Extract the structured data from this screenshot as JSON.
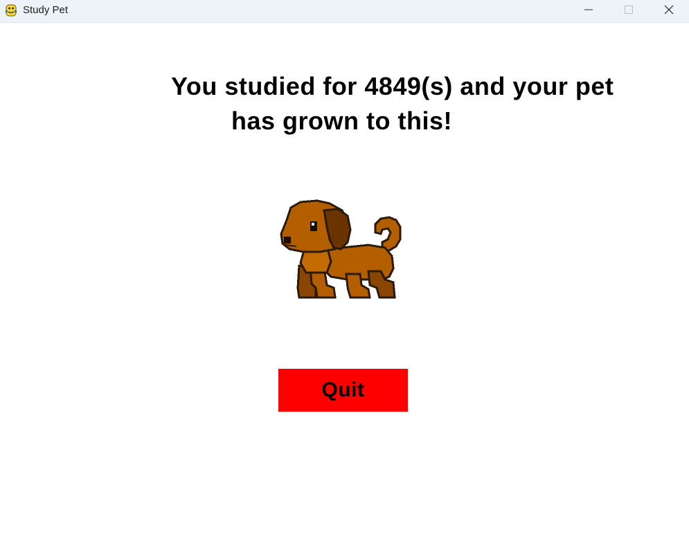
{
  "window": {
    "title": "Study Pet",
    "icon": "python-icon",
    "controls": {
      "minimize": "minimize-icon",
      "maximize": "maximize-icon",
      "close": "close-icon"
    }
  },
  "main": {
    "message_line_1": "You studied for 4849(s) and your pet",
    "message_line_2": "has grown to this!",
    "pet_image": "dog-sprite",
    "quit_label": "Quit"
  },
  "colors": {
    "titlebar": "#eef3f9",
    "quit_button": "#ff0000",
    "dog_body": "#b35f00",
    "dog_dark": "#6b3300",
    "outline": "#2a1a0a"
  }
}
